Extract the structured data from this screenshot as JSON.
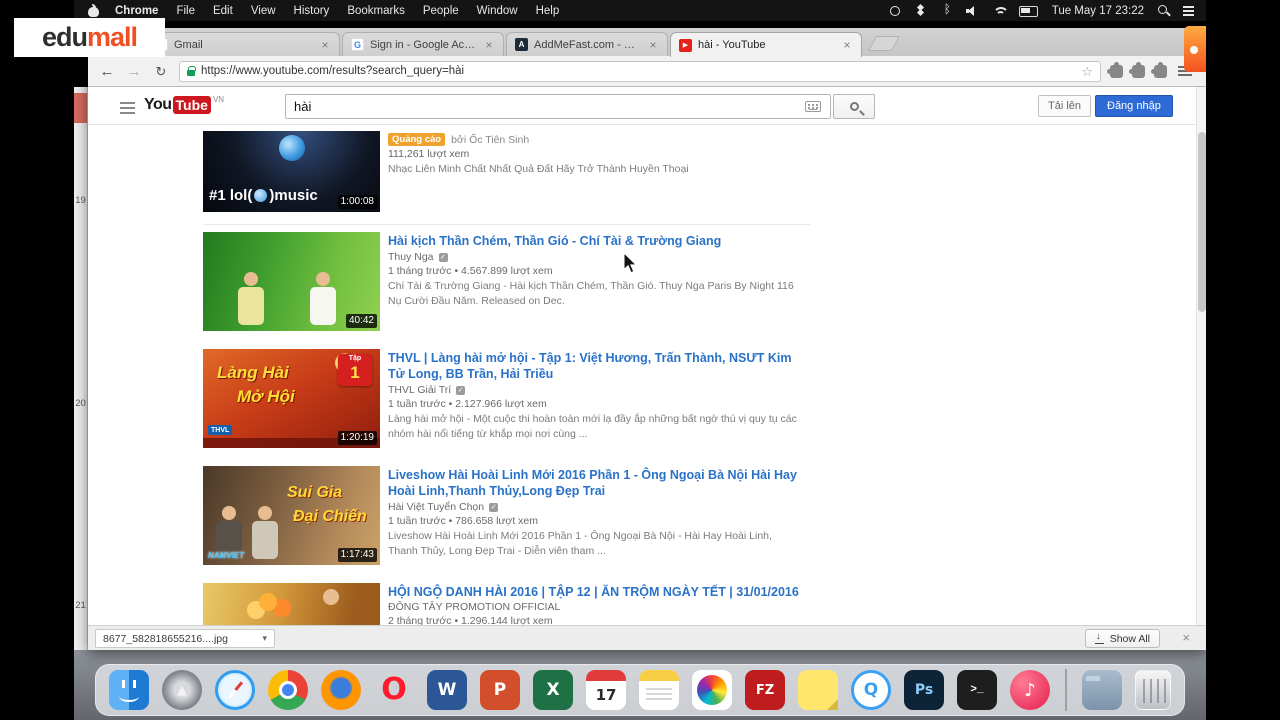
{
  "branding": {
    "edu": "edu",
    "mall": "mall"
  },
  "menu_bar": {
    "items": [
      "Chrome",
      "File",
      "Edit",
      "View",
      "History",
      "Bookmarks",
      "People",
      "Window",
      "Help"
    ],
    "status_icons_left": [
      "circle",
      "dropbox",
      "bluetooth",
      "volume",
      "wifi",
      "battery"
    ],
    "status_icons_right": [
      "spotlight",
      "notification"
    ],
    "clock": "Tue May 17 23:22"
  },
  "excel_rows": [
    "19",
    "20",
    "21"
  ],
  "browser": {
    "tabs": [
      {
        "title": "Gmail"
      },
      {
        "title": "Sign in - Google Accounts"
      },
      {
        "title": "AddMeFast.com - Please c"
      },
      {
        "title": "hài - YouTube"
      }
    ],
    "url": "https://www.youtube.com/results?search_query=hài",
    "download_bar": {
      "filename": "8677_582818655216....jpg",
      "show_all": "Show All"
    }
  },
  "youtube": {
    "logo_you": "You",
    "logo_tube": "Tube",
    "logo_region": "VN",
    "search_value": "hài",
    "upload_button": "Tải lên",
    "signin_button": "Đăng nhập"
  },
  "colors": {
    "signin_blue": "#2d6ad6",
    "youtube_red": "#cc181e",
    "title_link_blue": "#2a72c8",
    "ad_badge_orange": "#efa32e"
  },
  "results": [
    {
      "type": "ad",
      "ad_badge": "Quảng cáo",
      "ad_by": "bởi Ốc Tiên Sinh",
      "views": "111,261 lượt xem",
      "description": "Nhạc Liên Minh Chất Nhất Quả Đất Hãy Trở Thành Huyền Thoại",
      "duration": "1:00:08",
      "thumb_left": "#1 lol(",
      "thumb_right": ")music"
    },
    {
      "title": "Hài kịch Thần Chém, Thần Gió - Chí Tài & Trường Giang",
      "channel": "Thuy Nga",
      "meta": "1 tháng trước • 4.567.899 lượt xem",
      "description": "Chí Tài & Trường Giang - Hài kịch Thần Chém, Thần Gió. Thuy Nga Paris By Night 116 Nụ Cười Đầu Năm. Released on Dec.",
      "duration": "40:42"
    },
    {
      "title": "THVL | Làng hài mở hội - Tập 1: Việt Hương, Trấn Thành, NSƯT Kim Tử Long, BB Trần, Hải Triều",
      "channel": "THVL Giải Trí",
      "meta": "1 tuần trước • 2.127.966 lượt xem",
      "description": "Làng hài mở hội - Một cuộc thi hoàn toàn mới lạ đầy ắp những bất ngờ thú vị quy tụ các nhóm hài nổi tiếng từ khắp mọi nơi cùng ...",
      "duration": "1:20:19",
      "thumb": {
        "line1": "Làng Hài",
        "line2": "Mở Hội",
        "badge_top": "Tập",
        "badge_num": "1",
        "logo": "THVL"
      }
    },
    {
      "title": "Liveshow Hài Hoài Linh Mới 2016 Phần 1 - Ông Ngoại Bà Nội Hài Hay Hoài Linh,Thanh Thủy,Long Đẹp Trai",
      "channel": "Hài Việt Tuyển Chọn",
      "meta": "1 tuần trước • 786.658 lượt xem",
      "description": "Liveshow Hài Hoài Linh Mới 2016 Phần 1 - Ông Ngoại Bà Nội - Hài Hay Hoài Linh, Thanh Thủy, Long Đẹp Trai - Diễn viên tham ...",
      "duration": "1:17:43",
      "thumb": {
        "line1": "Sui Gia",
        "line2": "Đại Chiến",
        "logo": "NAMVIET"
      }
    },
    {
      "title": "HỘI NGỘ DANH HÀI 2016 | TẬP 12 | ĂN TRỘM NGÀY TẾT | 31/01/2016",
      "channel": "ĐÔNG TÂY PROMOTION OFFICIAL",
      "meta": "2 tháng trước • 1.296.144 lượt xem"
    }
  ],
  "dock": {
    "items": [
      {
        "id": "finder",
        "glyph": ""
      },
      {
        "id": "launchpad",
        "glyph": "▲"
      },
      {
        "id": "safari",
        "glyph": ""
      },
      {
        "id": "chrome",
        "glyph": ""
      },
      {
        "id": "firefox",
        "glyph": ""
      },
      {
        "id": "opera",
        "glyph": "O"
      },
      {
        "id": "word",
        "glyph": "W"
      },
      {
        "id": "powerpoint",
        "glyph": "P"
      },
      {
        "id": "excel",
        "glyph": "X"
      },
      {
        "id": "calendar",
        "glyph": "17"
      },
      {
        "id": "notes",
        "glyph": ""
      },
      {
        "id": "photos",
        "glyph": ""
      },
      {
        "id": "filezilla",
        "glyph": "FZ"
      },
      {
        "id": "stickies",
        "glyph": ""
      },
      {
        "id": "quicktime",
        "glyph": "Q"
      },
      {
        "id": "photoshop",
        "glyph": "Ps"
      },
      {
        "id": "terminal",
        "glyph": ">_"
      },
      {
        "id": "itunes",
        "glyph": "♪"
      },
      {
        "id": "separator"
      },
      {
        "id": "downloads",
        "glyph": ""
      },
      {
        "id": "trash",
        "glyph": ""
      }
    ]
  }
}
